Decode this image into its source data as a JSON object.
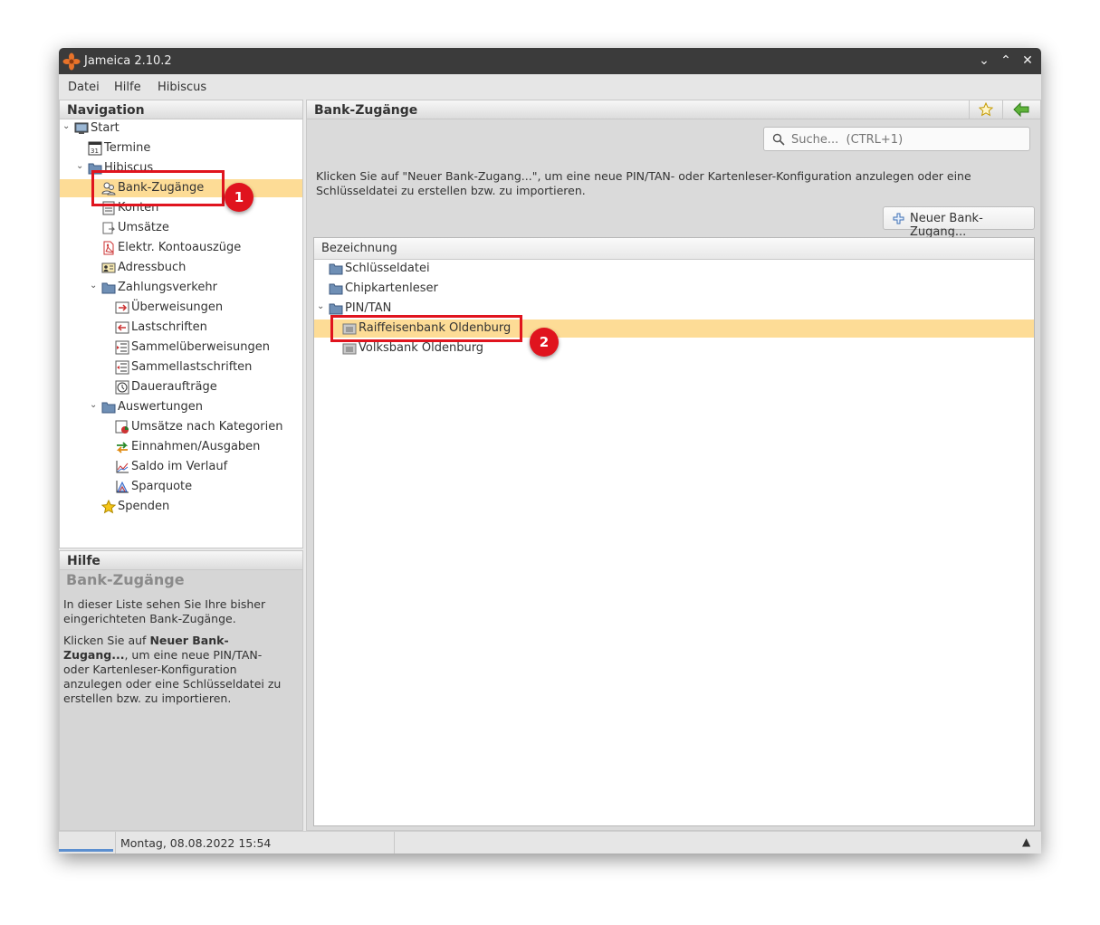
{
  "window": {
    "title": "Jameica 2.10.2"
  },
  "menu": [
    "Datei",
    "Hilfe",
    "Hibiscus"
  ],
  "navigation": {
    "header": "Navigation",
    "items": [
      {
        "label": "Start",
        "icon": "monitor-icon"
      },
      {
        "label": "Termine",
        "icon": "calendar-icon"
      },
      {
        "label": "Hibiscus",
        "icon": "folder-icon"
      },
      {
        "label": "Bank-Zugänge",
        "icon": "users-icon"
      },
      {
        "label": "Konten",
        "icon": "account-icon"
      },
      {
        "label": "Umsätze",
        "icon": "transactions-icon"
      },
      {
        "label": "Elektr. Kontoauszüge",
        "icon": "pdf-icon"
      },
      {
        "label": "Adressbuch",
        "icon": "addressbook-icon"
      },
      {
        "label": "Zahlungsverkehr",
        "icon": "folder-icon"
      },
      {
        "label": "Überweisungen",
        "icon": "transfer-icon"
      },
      {
        "label": "Lastschriften",
        "icon": "debit-icon"
      },
      {
        "label": "Sammelüberweisungen",
        "icon": "bulk-transfer-icon"
      },
      {
        "label": "Sammellastschriften",
        "icon": "bulk-debit-icon"
      },
      {
        "label": "Daueraufträge",
        "icon": "clock-icon"
      },
      {
        "label": "Auswertungen",
        "icon": "folder-icon"
      },
      {
        "label": "Umsätze nach Kategorien",
        "icon": "pie-icon"
      },
      {
        "label": "Einnahmen/Ausgaben",
        "icon": "arrows-icon"
      },
      {
        "label": "Saldo im Verlauf",
        "icon": "line-chart-icon"
      },
      {
        "label": "Sparquote",
        "icon": "area-chart-icon"
      },
      {
        "label": "Spenden",
        "icon": "star-icon"
      }
    ]
  },
  "help": {
    "header": "Hilfe",
    "title": "Bank-Zugänge",
    "para1": " In dieser Liste sehen Sie Ihre bisher eingerichteten Bank-Zugänge.",
    "para2_prefix": " Klicken Sie auf ",
    "para2_bold": "Neuer Bank-Zugang...",
    "para2_suffix": ", um eine neue PIN/TAN- oder Kartenleser-Konfiguration anzulegen oder eine Schlüsseldatei zu erstellen bzw. zu importieren."
  },
  "main": {
    "header": "Bank-Zugänge",
    "search_placeholder": "Suche...  (CTRL+1)",
    "description": "Klicken Sie auf \"Neuer Bank-Zugang...\", um eine neue PIN/TAN- oder Kartenleser-Konfiguration anzulegen oder eine Schlüsseldatei zu erstellen bzw. zu importieren.",
    "new_button": "Neuer Bank-Zugang...",
    "column_header": "Bezeichnung",
    "rows": [
      {
        "label": "Schlüsseldatei",
        "icon": "folder-icon"
      },
      {
        "label": "Chipkartenleser",
        "icon": "folder-icon"
      },
      {
        "label": "PIN/TAN",
        "icon": "folder-icon"
      },
      {
        "label": "Raiffeisenbank Oldenburg",
        "icon": "bank-icon"
      },
      {
        "label": "Volksbank Oldenburg",
        "icon": "bank-icon"
      }
    ]
  },
  "status": {
    "datetime": "Montag, 08.08.2022 15:54"
  },
  "callouts": [
    "1",
    "2"
  ],
  "colors": {
    "selection": "#fddc96",
    "callout": "#e0141e",
    "titlebar": "#3b3b3b"
  }
}
